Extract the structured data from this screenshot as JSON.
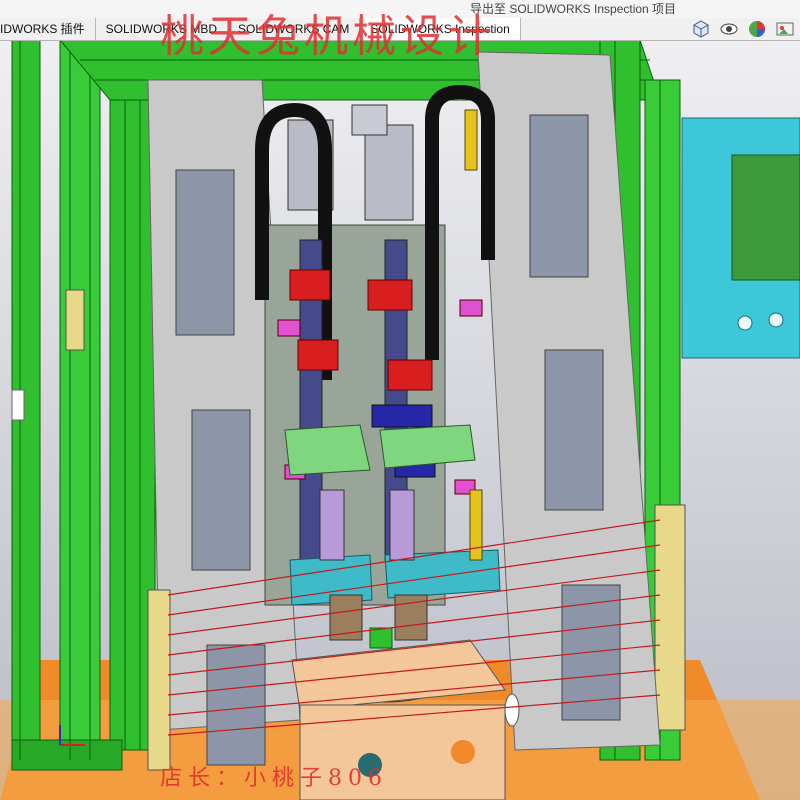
{
  "top_hint": "导出至 SOLIDWORKS Inspection 项目",
  "tabs": [
    {
      "label": "IDWORKS 插件"
    },
    {
      "label": "SOLIDWORKS MBD"
    },
    {
      "label": "SOLIDWORKS CAM"
    },
    {
      "label": "SOLIDWORKS Inspection"
    }
  ],
  "view_icons": [
    "view-orientation-icon",
    "hide-show-icon",
    "appearance-icon",
    "scene-icon"
  ],
  "watermark": {
    "title": "桃天兔机械设计",
    "footer": "店长：小桃子806"
  },
  "colors": {
    "frame_green": "#2fbf2f",
    "panel_gray": "#c9c9c9",
    "hmi_cyan": "#3cc8d8",
    "orange_base": "#f08a2a",
    "watermark_red": "#e03030"
  }
}
